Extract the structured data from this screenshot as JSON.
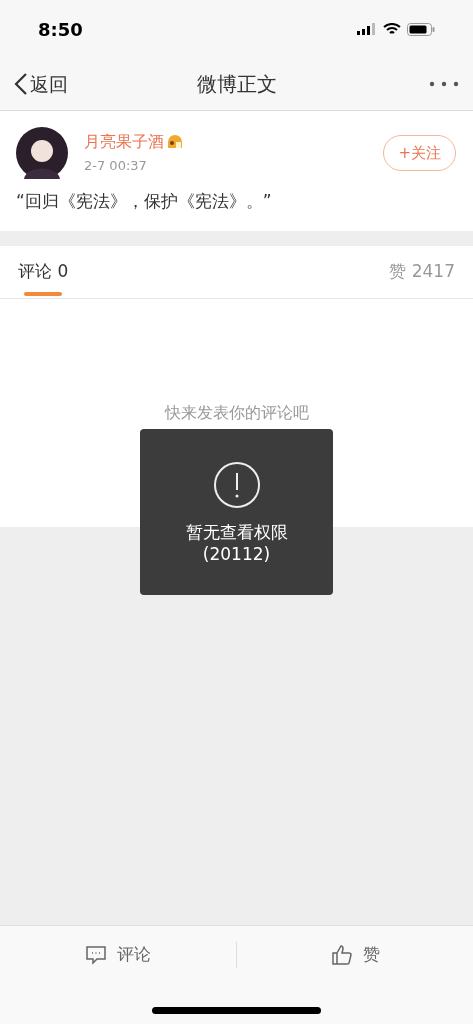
{
  "status_bar": {
    "time": "8:50"
  },
  "nav": {
    "back": "返回",
    "title": "微博正文"
  },
  "post": {
    "username": "月亮果子酒",
    "time": "2-7 00:37",
    "follow": "+关注",
    "text": "“回归《宪法》，保护《宪法》。”"
  },
  "tabs": [
    {
      "label": "评论 0",
      "selected": true
    },
    {
      "label": "赞 2417",
      "selected": false
    }
  ],
  "empty_hint": "快来发表你的评论吧",
  "toast": {
    "message": "暂无查看权限",
    "code": "(20112)"
  },
  "actions": [
    {
      "kind": "comment",
      "label": "评论"
    },
    {
      "kind": "like",
      "label": "赞"
    }
  ]
}
